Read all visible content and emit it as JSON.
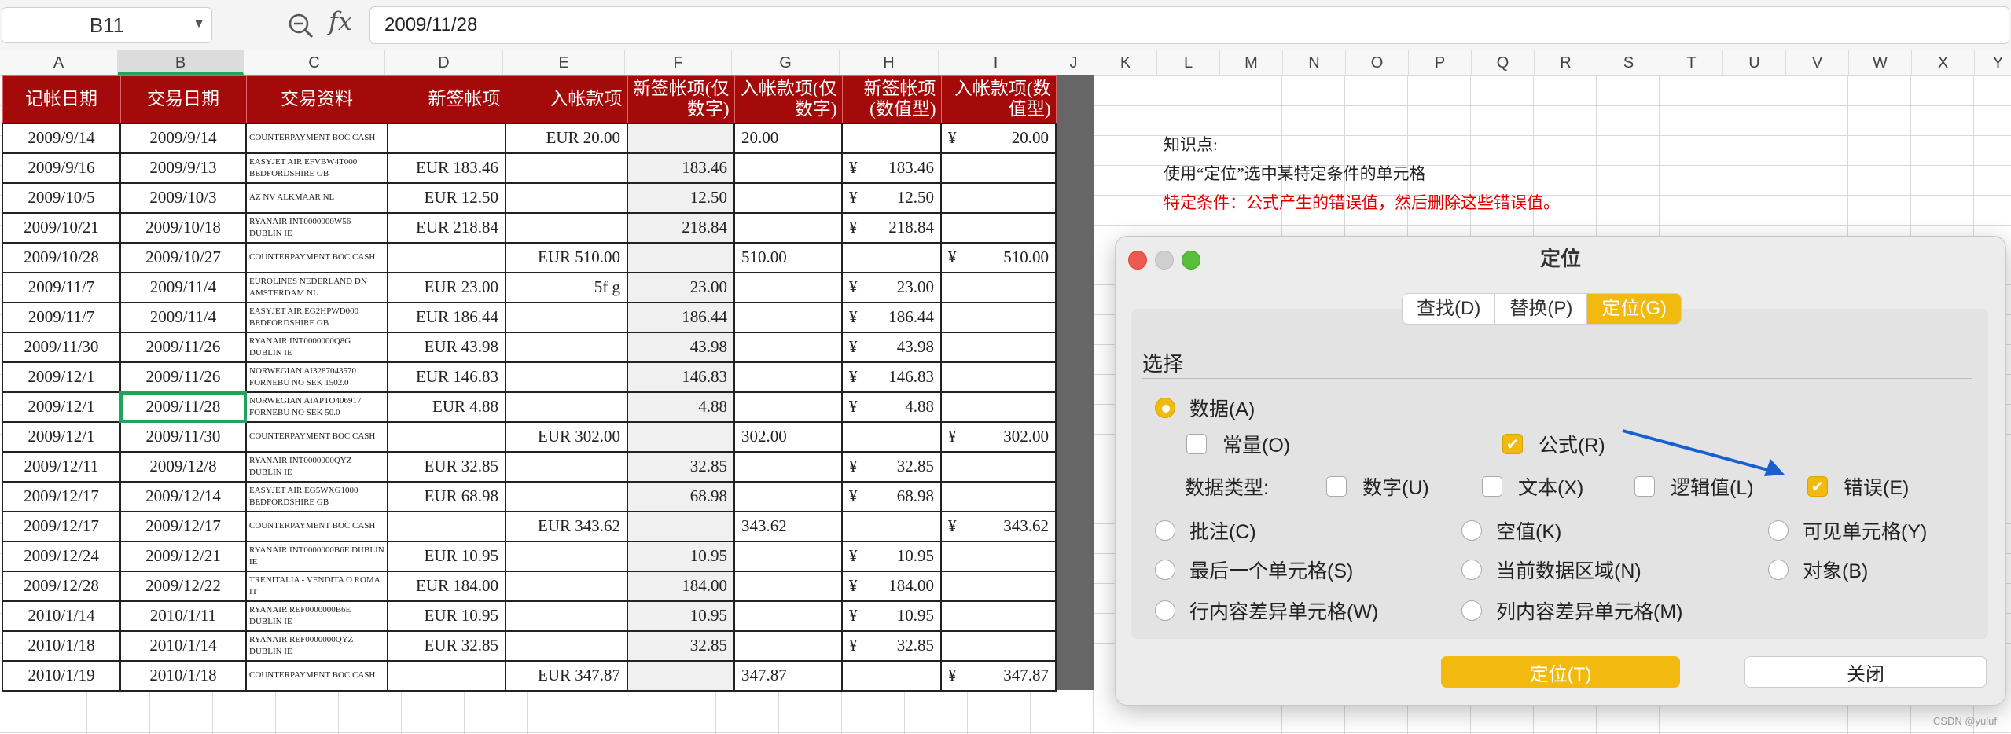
{
  "toolbar": {
    "name_box": "B11",
    "fx_label": "fx",
    "formula_value": "2009/11/28"
  },
  "columns": [
    "A",
    "B",
    "C",
    "D",
    "E",
    "F",
    "G",
    "H",
    "I",
    "J",
    "K",
    "L",
    "M",
    "N",
    "O",
    "P",
    "Q",
    "R",
    "S",
    "T",
    "U",
    "V",
    "W",
    "X",
    "Y"
  ],
  "table": {
    "headers": [
      "记帐日期",
      "交易日期",
      "交易资料",
      "新签帐项",
      "入帐款项",
      "新签帐项(仅数字)",
      "入帐款项(仅数字)",
      "新签帐项(数值型)",
      "入帐款项(数值型)"
    ],
    "rows": [
      [
        "2009/9/14",
        "2009/9/14",
        "COUNTERPAYMENT BOC CASH",
        "",
        "EUR 20.00",
        "",
        "20.00",
        "",
        "¥|20.00"
      ],
      [
        "2009/9/16",
        "2009/9/13",
        "EASYJET AIR EFVBW4T000 BEDFORDSHIRE GB",
        "EUR 183.46",
        "",
        "183.46",
        "",
        "¥|183.46",
        ""
      ],
      [
        "2009/10/5",
        "2009/10/3",
        "AZ NV ALKMAAR NL",
        "EUR 12.50",
        "",
        "12.50",
        "",
        "¥|12.50",
        ""
      ],
      [
        "2009/10/21",
        "2009/10/18",
        "RYANAIR INT0000000W56 DUBLIN IE",
        "EUR 218.84",
        "",
        "218.84",
        "",
        "¥|218.84",
        ""
      ],
      [
        "2009/10/28",
        "2009/10/27",
        "COUNTERPAYMENT BOC CASH",
        "",
        "EUR 510.00",
        "",
        "510.00",
        "",
        "¥|510.00"
      ],
      [
        "2009/11/7",
        "2009/11/4",
        "EUROLINES NEDERLAND DN AMSTERDAM NL",
        "EUR 23.00",
        "5f g",
        "23.00",
        "",
        "¥|23.00",
        ""
      ],
      [
        "2009/11/7",
        "2009/11/4",
        "EASYJET AIR EG2HPWD000 BEDFORDSHIRE GB",
        "EUR 186.44",
        "",
        "186.44",
        "",
        "¥|186.44",
        ""
      ],
      [
        "2009/11/30",
        "2009/11/26",
        "RYANAIR INT0000000Q8G DUBLIN IE",
        "EUR 43.98",
        "",
        "43.98",
        "",
        "¥|43.98",
        ""
      ],
      [
        "2009/12/1",
        "2009/11/26",
        "NORWEGIAN AI3287043570 FORNEBU NO SEK 1502.0",
        "EUR 146.83",
        "",
        "146.83",
        "",
        "¥|146.83",
        ""
      ],
      [
        "2009/12/1",
        "2009/11/28",
        "NORWEGIAN AIAPTO406917 FORNEBU NO SEK 50.0",
        "EUR 4.88",
        "",
        "4.88",
        "",
        "¥|4.88",
        ""
      ],
      [
        "2009/12/1",
        "2009/11/30",
        "COUNTERPAYMENT BOC CASH",
        "",
        "EUR 302.00",
        "",
        "302.00",
        "",
        "¥|302.00"
      ],
      [
        "2009/12/11",
        "2009/12/8",
        "RYANAIR INT0000000QYZ DUBLIN IE",
        "EUR 32.85",
        "",
        "32.85",
        "",
        "¥|32.85",
        ""
      ],
      [
        "2009/12/17",
        "2009/12/14",
        "EASYJET AIR EG5WXG1000 BEDFORDSHIRE GB",
        "EUR 68.98",
        "",
        "68.98",
        "",
        "¥|68.98",
        ""
      ],
      [
        "2009/12/17",
        "2009/12/17",
        "COUNTERPAYMENT BOC CASH",
        "",
        "EUR 343.62",
        "",
        "343.62",
        "",
        "¥|343.62"
      ],
      [
        "2009/12/24",
        "2009/12/21",
        "RYANAIR INT0000000B6E DUBLIN IE",
        "EUR 10.95",
        "",
        "10.95",
        "",
        "¥|10.95",
        ""
      ],
      [
        "2009/12/28",
        "2009/12/22",
        "TRENITALIA - VENDITA O ROMA IT",
        "EUR 184.00",
        "",
        "184.00",
        "",
        "¥|184.00",
        ""
      ],
      [
        "2010/1/14",
        "2010/1/11",
        "RYANAIR REF0000000B6E DUBLIN IE",
        "EUR 10.95",
        "",
        "10.95",
        "",
        "¥|10.95",
        ""
      ],
      [
        "2010/1/18",
        "2010/1/14",
        "RYANAIR REF0000000QYZ DUBLIN IE",
        "EUR 32.85",
        "",
        "32.85",
        "",
        "¥|32.85",
        ""
      ],
      [
        "2010/1/19",
        "2010/1/18",
        "COUNTERPAYMENT BOC CASH",
        "",
        "EUR 347.87",
        "",
        "347.87",
        "",
        "¥|347.87"
      ]
    ]
  },
  "notes": {
    "line1": "知识点:",
    "line2": "使用“定位”选中某特定条件的单元格",
    "line3": "特定条件：公式产生的错误值，然后删除这些错误值。"
  },
  "dialog": {
    "title": "定位",
    "tabs": [
      "查找(D)",
      "替换(P)",
      "定位(G)"
    ],
    "section": "选择",
    "opt_data": "数据(A)",
    "opt_const": "常量(O)",
    "opt_formula": "公式(R)",
    "data_type_label": "数据类型:",
    "opt_number": "数字(U)",
    "opt_text": "文本(X)",
    "opt_logical": "逻辑值(L)",
    "opt_error": "错误(E)",
    "opt_comment": "批注(C)",
    "opt_blank": "空值(K)",
    "opt_visible": "可见单元格(Y)",
    "opt_last": "最后一个单元格(S)",
    "opt_region": "当前数据区域(N)",
    "opt_object": "对象(B)",
    "opt_rowdiff": "行内容差异单元格(W)",
    "opt_coldiff": "列内容差异单元格(M)",
    "btn_goto": "定位(T)",
    "btn_close": "关闭"
  },
  "watermark": "CSDN @yuluf",
  "colors": {
    "header_red": "#a50a0a",
    "accent_yellow": "#f2b90f",
    "selection_green": "#22a35a",
    "arrow_blue": "#1a5fd0"
  }
}
